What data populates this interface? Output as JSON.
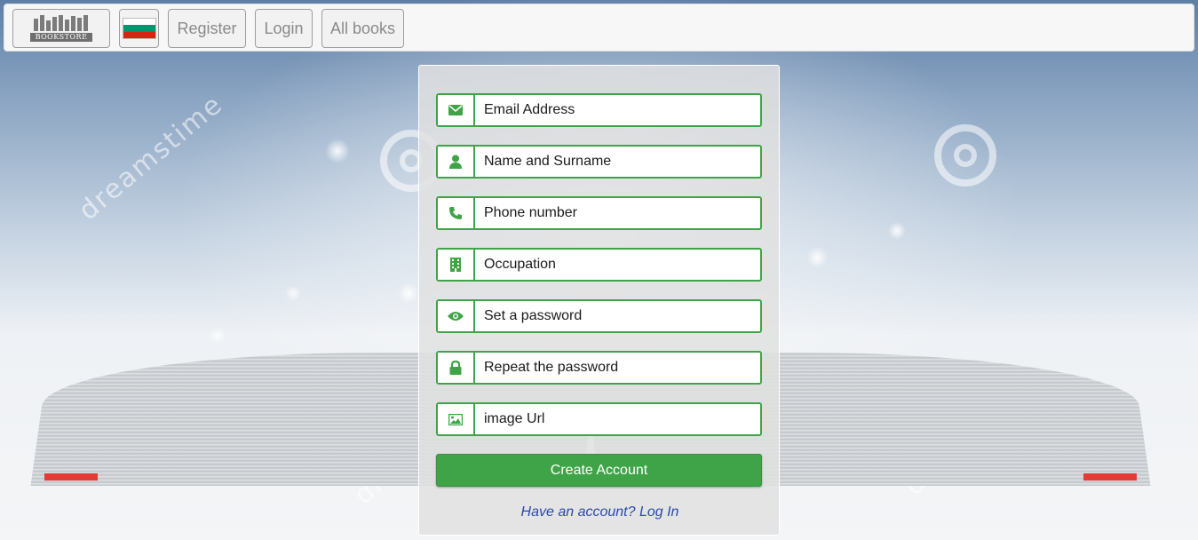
{
  "navbar": {
    "logo_text": "BOOKSTORE",
    "flag_colors": [
      "#ffffff",
      "#00966e",
      "#d62612"
    ],
    "register_label": "Register",
    "login_label": "Login",
    "all_books_label": "All books"
  },
  "background": {
    "watermark_text": "dreamstime"
  },
  "form": {
    "fields": [
      {
        "icon": "envelope-icon",
        "placeholder": "Email Address"
      },
      {
        "icon": "user-icon",
        "placeholder": "Name and Surname"
      },
      {
        "icon": "phone-icon",
        "placeholder": "Phone number"
      },
      {
        "icon": "building-icon",
        "placeholder": "Occupation"
      },
      {
        "icon": "eye-icon",
        "placeholder": "Set a password"
      },
      {
        "icon": "lock-icon",
        "placeholder": "Repeat the password"
      },
      {
        "icon": "image-icon",
        "placeholder": "image Url"
      }
    ],
    "submit_label": "Create Account",
    "login_link_label": "Have an account? Log In"
  },
  "colors": {
    "accent": "#3fa447",
    "link": "#2b4aa8"
  }
}
